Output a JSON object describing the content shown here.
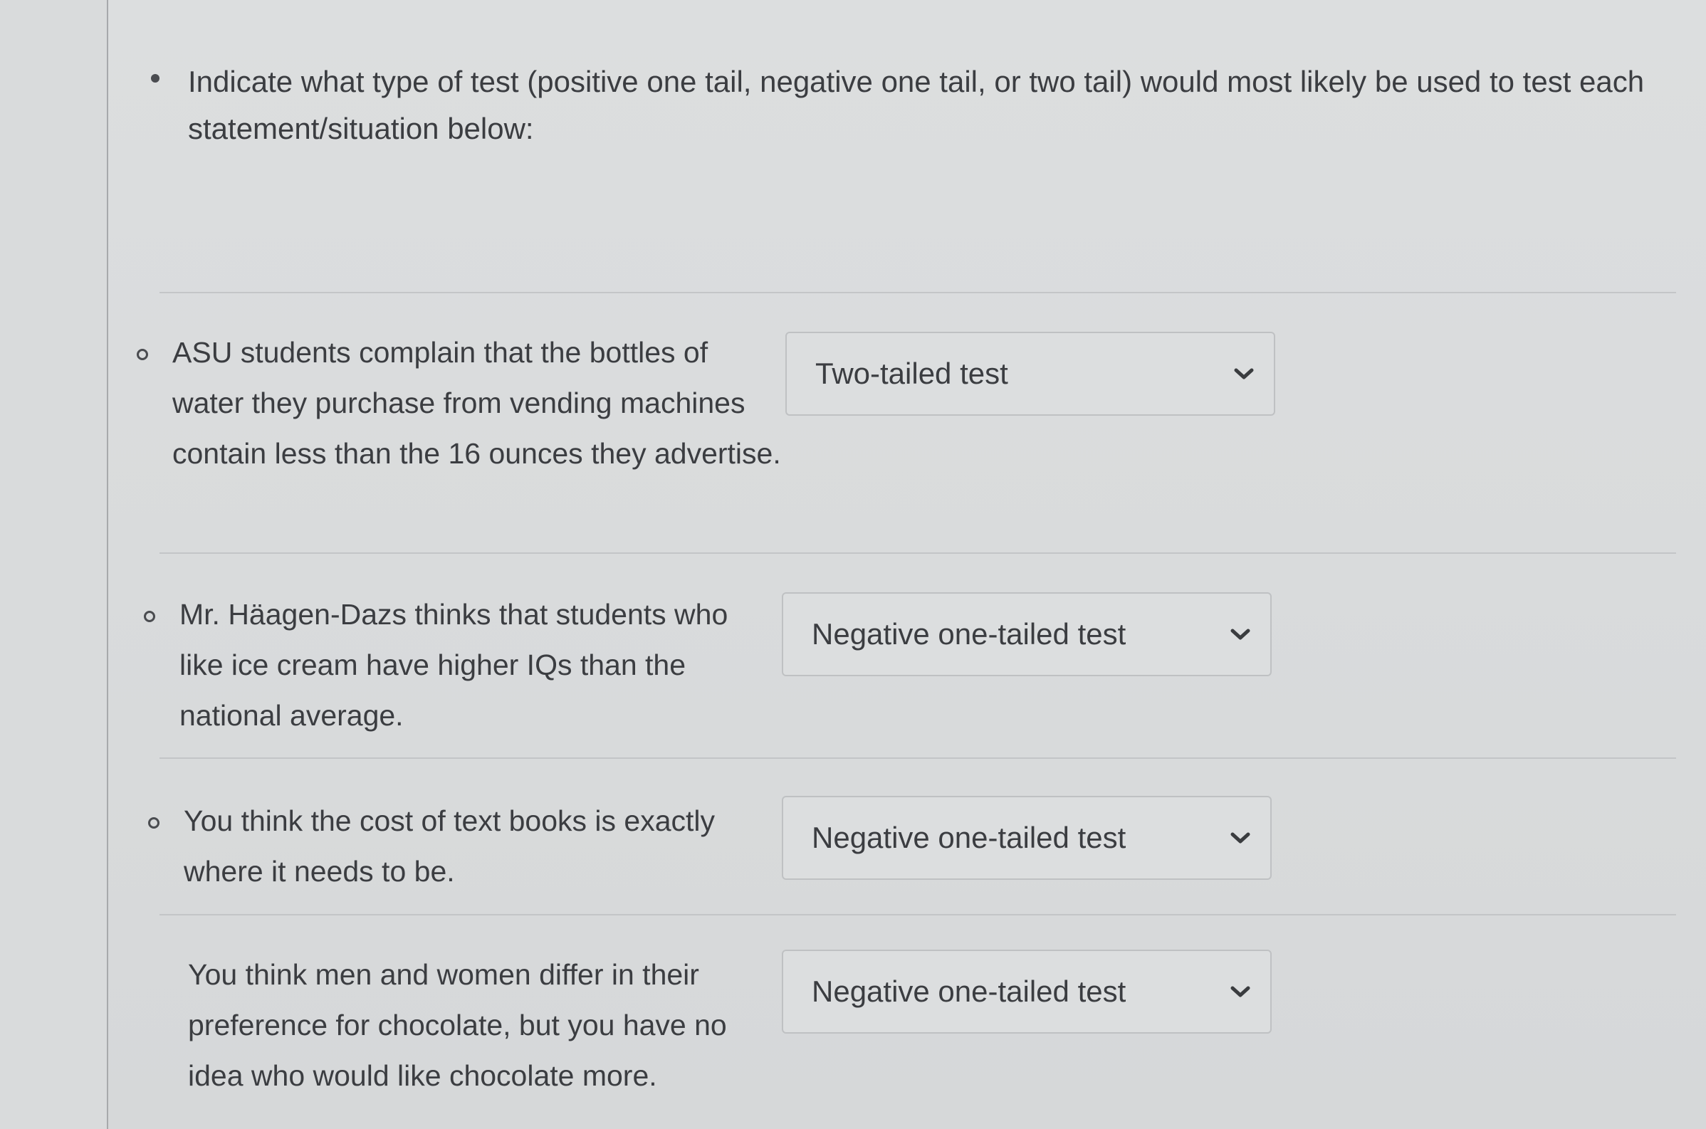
{
  "instruction": {
    "text": "Indicate what type of test (positive one tail, negative one tail, or two tail) would most likely be used to test each statement/situation below:"
  },
  "items": [
    {
      "text": "ASU students complain that the bottles of water they purchase from vending machines contain less than the 16 ounces they advertise.",
      "selected": "Two-tailed test"
    },
    {
      "text": "Mr. Häagen-Dazs thinks that students who like ice cream have higher IQs than the national average.",
      "selected": "Negative one-tailed test"
    },
    {
      "text": "You think the cost of text books is exactly where it needs to be.",
      "selected": "Negative one-tailed test"
    },
    {
      "text": "You think men and women differ in their preference for chocolate, but you have no idea who would like chocolate more.",
      "selected": "Negative one-tailed test"
    }
  ],
  "icons": {
    "dropdown": "chevron-down-icon",
    "bullet": "bullet-disc-icon",
    "sub_bullet": "circle-bullet-icon"
  }
}
